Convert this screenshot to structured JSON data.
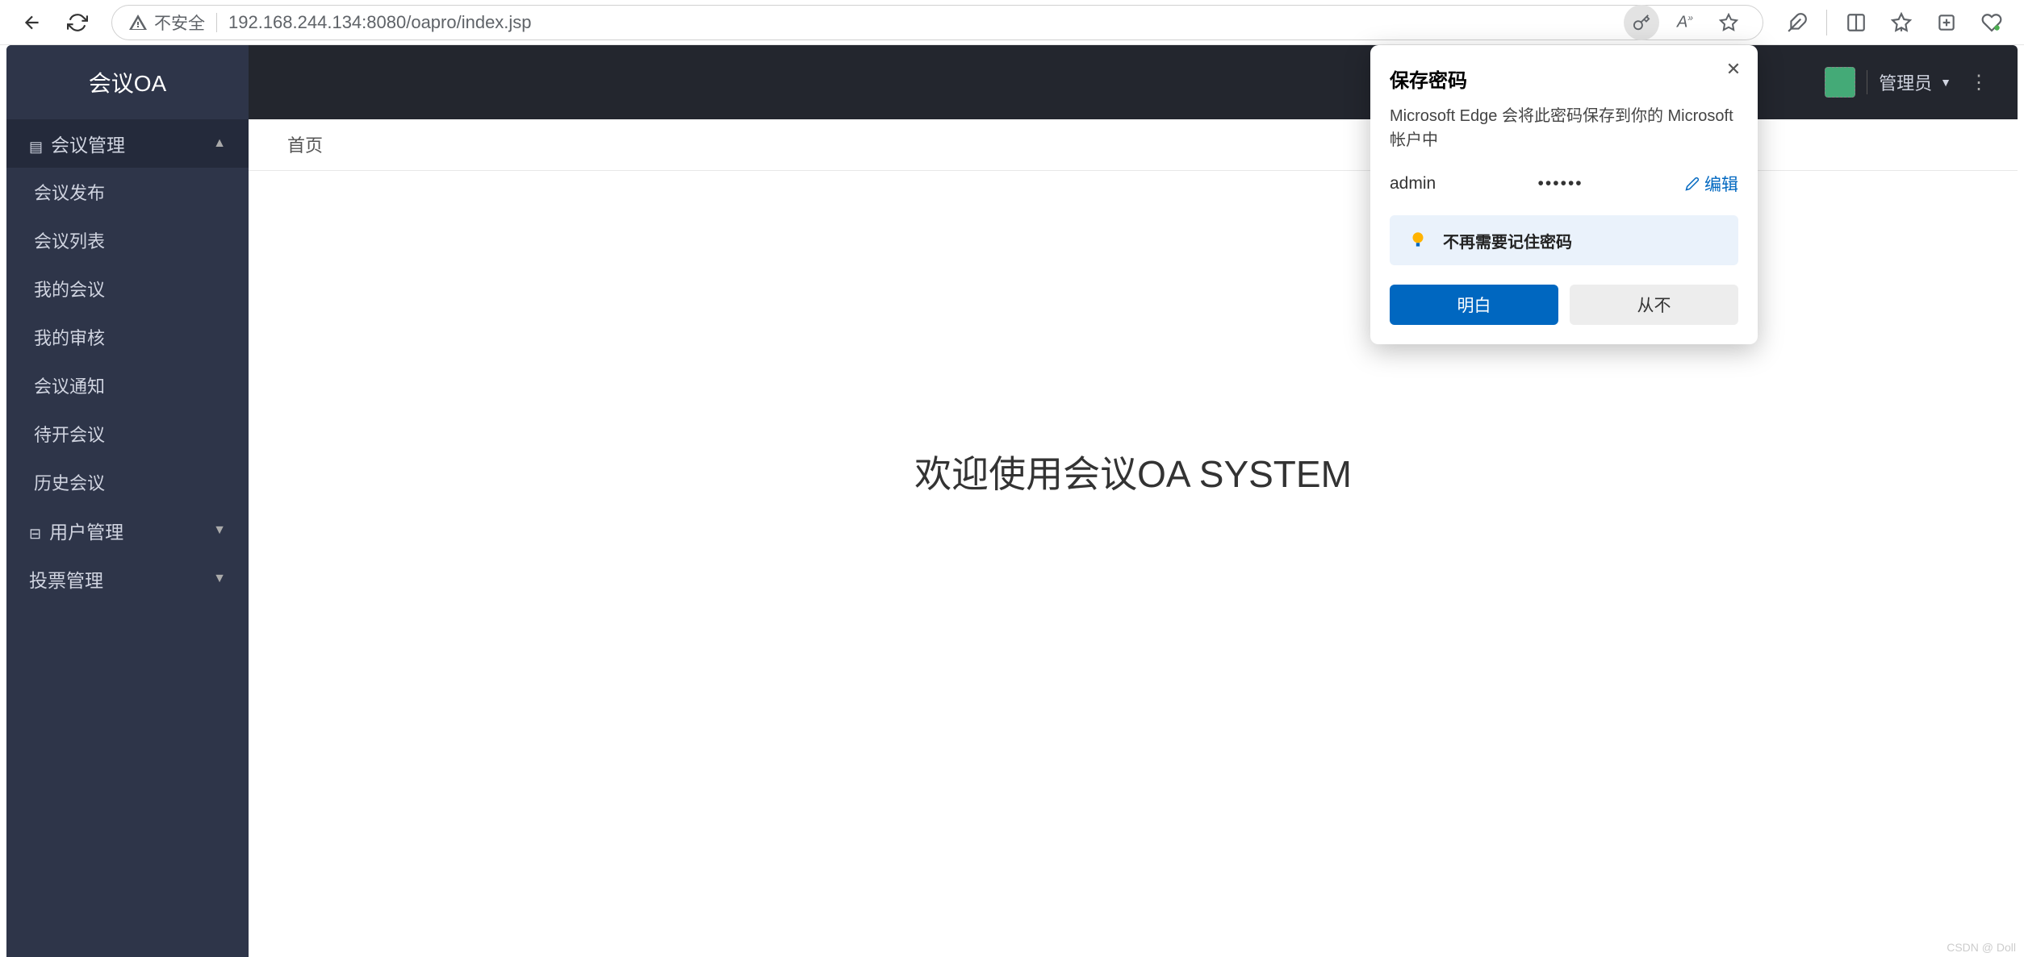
{
  "browser": {
    "insecure_label": "不安全",
    "url": "192.168.244.134:8080/oapro/index.jsp"
  },
  "sidebar": {
    "brand": "会议OA",
    "sections": [
      {
        "label": "会议管理",
        "expanded": true
      },
      {
        "label": "用户管理",
        "expanded": false
      },
      {
        "label": "投票管理",
        "expanded": false
      }
    ],
    "meeting_items": [
      "会议发布",
      "会议列表",
      "我的会议",
      "我的审核",
      "会议通知",
      "待开会议",
      "历史会议"
    ]
  },
  "topbar": {
    "username": "管理员"
  },
  "tabs": {
    "home": "首页"
  },
  "content": {
    "welcome": "欢迎使用会议OA SYSTEM"
  },
  "popup": {
    "title": "保存密码",
    "description": "Microsoft Edge 会将此密码保存到你的 Microsoft 帐户中",
    "username": "admin",
    "password_mask": "••••••",
    "edit": "编辑",
    "info": "不再需要记住密码",
    "primary_btn": "明白",
    "secondary_btn": "从不"
  },
  "watermark": "CSDN @ Doll"
}
